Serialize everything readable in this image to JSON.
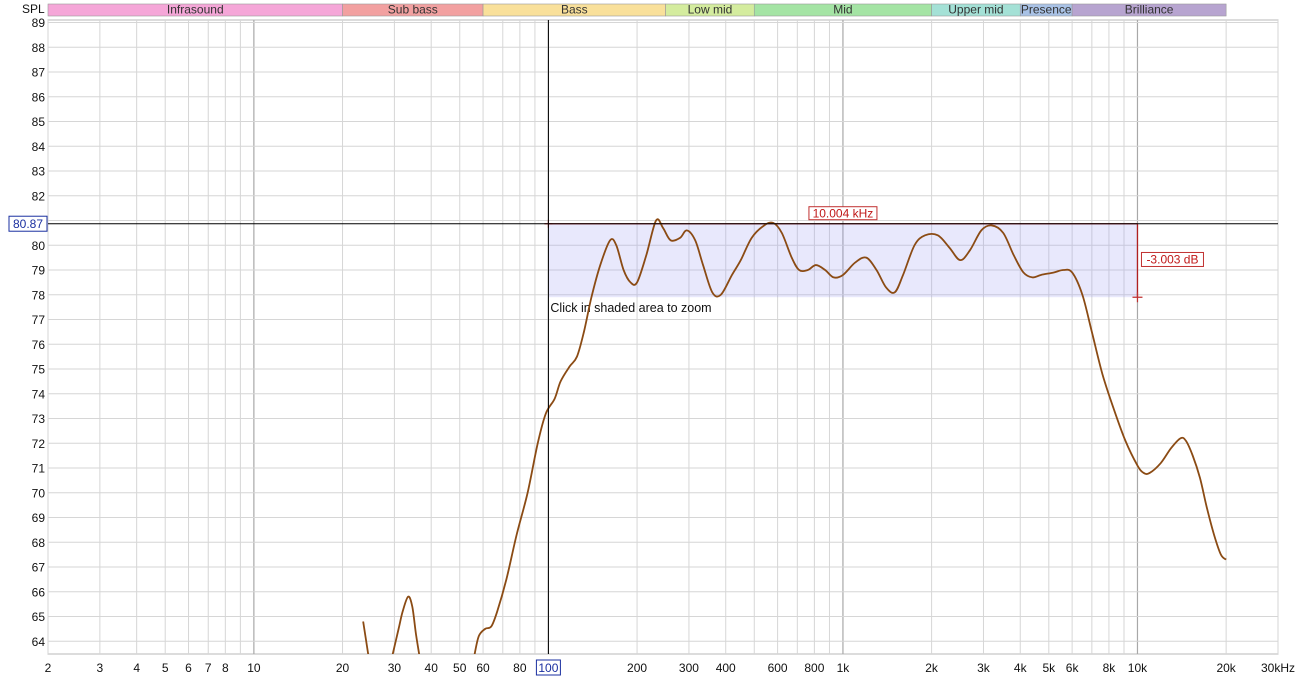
{
  "chart_data": {
    "type": "line",
    "ylabel": "SPL",
    "xlabel": "",
    "x_scale": "log",
    "xlim": [
      2,
      30000
    ],
    "ylim": [
      63.4,
      89
    ],
    "grid": true,
    "y_ticks": [
      89,
      88,
      87,
      86,
      85,
      84,
      83,
      82,
      81,
      80,
      79,
      78,
      77,
      76,
      75,
      74,
      73,
      72,
      71,
      70,
      69,
      68,
      67,
      66,
      65,
      64
    ],
    "y_tick_labels": [
      "89",
      "88",
      "87",
      "86",
      "85",
      "84",
      "83",
      "82",
      "",
      "80",
      "79",
      "78",
      "77",
      "76",
      "75",
      "74",
      "73",
      "72",
      "71",
      "70",
      "69",
      "68",
      "67",
      "66",
      "65",
      "64"
    ],
    "x_ticks": [
      {
        "value": 2,
        "label": "2"
      },
      {
        "value": 3,
        "label": "3"
      },
      {
        "value": 4,
        "label": "4"
      },
      {
        "value": 5,
        "label": "5"
      },
      {
        "value": 6,
        "label": "6"
      },
      {
        "value": 7,
        "label": "7"
      },
      {
        "value": 8,
        "label": "8"
      },
      {
        "value": 10,
        "label": "10"
      },
      {
        "value": 20,
        "label": "20"
      },
      {
        "value": 30,
        "label": "30"
      },
      {
        "value": 40,
        "label": "40"
      },
      {
        "value": 50,
        "label": "50"
      },
      {
        "value": 60,
        "label": "60"
      },
      {
        "value": 80,
        "label": "80"
      },
      {
        "value": 100,
        "label": "100"
      },
      {
        "value": 200,
        "label": "200"
      },
      {
        "value": 300,
        "label": "300"
      },
      {
        "value": 400,
        "label": "400"
      },
      {
        "value": 600,
        "label": "600"
      },
      {
        "value": 800,
        "label": "800"
      },
      {
        "value": 1000,
        "label": "1k"
      },
      {
        "value": 2000,
        "label": "2k"
      },
      {
        "value": 3000,
        "label": "3k"
      },
      {
        "value": 4000,
        "label": "4k"
      },
      {
        "value": 5000,
        "label": "5k"
      },
      {
        "value": 6000,
        "label": "6k"
      },
      {
        "value": 8000,
        "label": "8k"
      },
      {
        "value": 10000,
        "label": "10k"
      },
      {
        "value": 20000,
        "label": "20k"
      },
      {
        "value": 30000,
        "label": "30kHz"
      }
    ],
    "bands": [
      {
        "label": "Infrasound",
        "start": 2,
        "end": 20,
        "color": "#f5a6d8"
      },
      {
        "label": "Sub bass",
        "start": 20,
        "end": 60,
        "color": "#f2a0a0"
      },
      {
        "label": "Bass",
        "start": 60,
        "end": 250,
        "color": "#f9e09a"
      },
      {
        "label": "Low mid",
        "start": 250,
        "end": 500,
        "color": "#d4ec9e"
      },
      {
        "label": "Mid",
        "start": 500,
        "end": 2000,
        "color": "#a4e4a4"
      },
      {
        "label": "Upper mid",
        "start": 2000,
        "end": 4000,
        "color": "#a4e1d6"
      },
      {
        "label": "Presence",
        "start": 4000,
        "end": 6000,
        "color": "#a9c2e6"
      },
      {
        "label": "Brilliance",
        "start": 6000,
        "end": 20000,
        "color": "#b7a4d0"
      }
    ],
    "series": [
      {
        "color": "#8b4b14",
        "segments": [
          [
            [
              23.5,
              64.8
            ],
            [
              24.5,
              63.4
            ]
          ],
          [
            [
              29.5,
              63.4
            ],
            [
              31,
              64.5
            ],
            [
              32,
              65.2
            ],
            [
              33.4,
              65.8
            ],
            [
              34.5,
              65.4
            ],
            [
              35.5,
              64.3
            ],
            [
              36.5,
              63.4
            ]
          ],
          [
            [
              56,
              63.4
            ],
            [
              58,
              64.2
            ],
            [
              61,
              64.5
            ],
            [
              64,
              64.6
            ],
            [
              67,
              65.2
            ],
            [
              72,
              66.5
            ],
            [
              78,
              68.3
            ],
            [
              85,
              70.0
            ],
            [
              92,
              72.0
            ],
            [
              98,
              73.2
            ],
            [
              105,
              73.8
            ],
            [
              110,
              74.5
            ],
            [
              118,
              75.1
            ],
            [
              125,
              75.5
            ],
            [
              132,
              76.5
            ],
            [
              140,
              77.9
            ],
            [
              150,
              79.2
            ],
            [
              162,
              80.2
            ],
            [
              170,
              80.0
            ],
            [
              180,
              79.0
            ],
            [
              190,
              78.5
            ],
            [
              200,
              78.5
            ],
            [
              215,
              79.6
            ],
            [
              232,
              81.0
            ],
            [
              245,
              80.7
            ],
            [
              260,
              80.2
            ],
            [
              280,
              80.3
            ],
            [
              295,
              80.6
            ],
            [
              315,
              80.2
            ],
            [
              335,
              79.2
            ],
            [
              360,
              78.1
            ],
            [
              385,
              78.0
            ],
            [
              420,
              78.8
            ],
            [
              450,
              79.4
            ],
            [
              490,
              80.3
            ],
            [
              540,
              80.8
            ],
            [
              580,
              80.9
            ],
            [
              620,
              80.5
            ],
            [
              670,
              79.5
            ],
            [
              710,
              79.0
            ],
            [
              760,
              79.0
            ],
            [
              810,
              79.2
            ],
            [
              870,
              79.0
            ],
            [
              930,
              78.7
            ],
            [
              1000,
              78.8
            ],
            [
              1100,
              79.3
            ],
            [
              1200,
              79.5
            ],
            [
              1300,
              79.0
            ],
            [
              1400,
              78.3
            ],
            [
              1500,
              78.1
            ],
            [
              1600,
              78.8
            ],
            [
              1750,
              80.0
            ],
            [
              1900,
              80.4
            ],
            [
              2100,
              80.4
            ],
            [
              2300,
              79.9
            ],
            [
              2500,
              79.4
            ],
            [
              2700,
              79.8
            ],
            [
              2950,
              80.6
            ],
            [
              3200,
              80.8
            ],
            [
              3500,
              80.5
            ],
            [
              3800,
              79.6
            ],
            [
              4100,
              78.9
            ],
            [
              4400,
              78.7
            ],
            [
              4700,
              78.8
            ],
            [
              5200,
              78.9
            ],
            [
              5600,
              79.0
            ],
            [
              6000,
              78.9
            ],
            [
              6500,
              78.0
            ],
            [
              7000,
              76.5
            ],
            [
              7600,
              74.8
            ],
            [
              8300,
              73.4
            ],
            [
              9100,
              72.1
            ],
            [
              10000,
              71.1
            ],
            [
              10500,
              70.8
            ],
            [
              11000,
              70.8
            ],
            [
              12000,
              71.2
            ],
            [
              13000,
              71.8
            ],
            [
              14000,
              72.2
            ],
            [
              14600,
              72.1
            ],
            [
              15400,
              71.5
            ],
            [
              16300,
              70.6
            ],
            [
              17200,
              69.4
            ],
            [
              18200,
              68.3
            ],
            [
              19200,
              67.5
            ],
            [
              20000,
              67.3
            ]
          ]
        ]
      }
    ],
    "cursor": {
      "frequency": 100,
      "level": 80.87,
      "x_label": "100",
      "y_label": "80.87"
    },
    "selection": {
      "start_freq": 100,
      "end_freq": 10000,
      "top_level": 80.87,
      "bottom_level": 77.9,
      "width_label": "10.004 kHz",
      "height_label": "-3.003 dB",
      "hint": "Click in shaded area to zoom"
    }
  }
}
